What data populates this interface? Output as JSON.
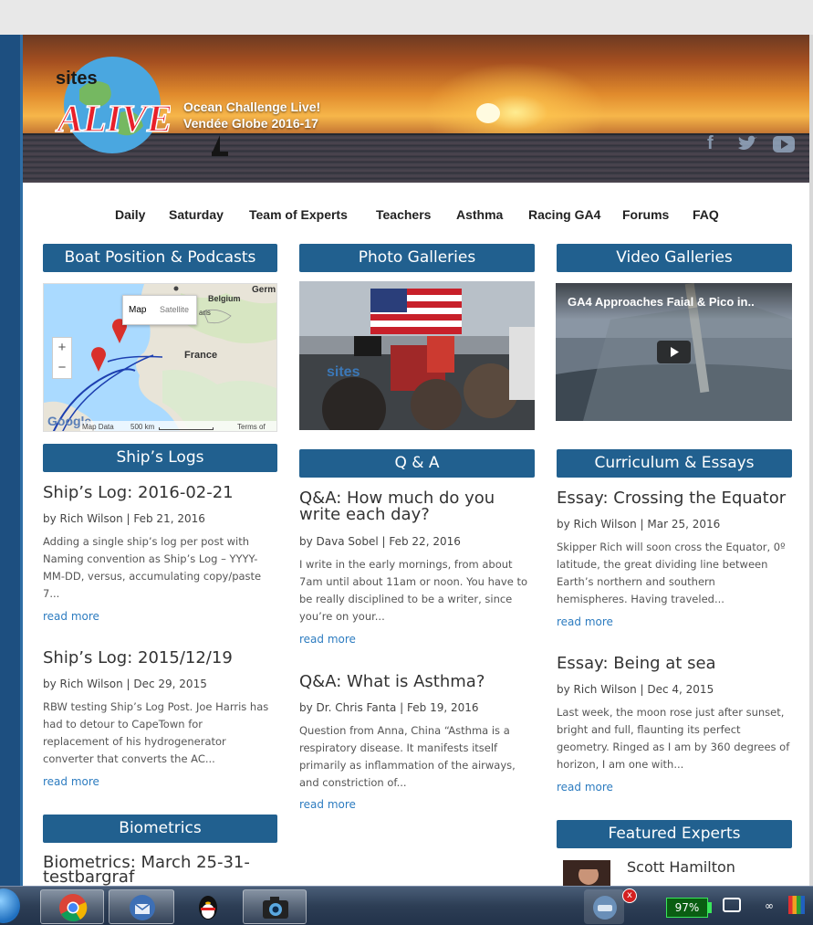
{
  "header": {
    "logo_text_top": "sites",
    "logo_text_main": "ALIVE!",
    "tagline_line1": "Ocean Challenge Live!",
    "tagline_line2": "Vendée Globe 2016-17",
    "social_icons": [
      "facebook-icon",
      "twitter-icon",
      "youtube-icon"
    ]
  },
  "nav": {
    "items": [
      "Daily",
      "Saturday",
      "Team of Experts",
      "Teachers",
      "Asthma",
      "Racing GA4",
      "Forums",
      "FAQ"
    ]
  },
  "sections": {
    "boat_position": "Boat Position & Podcasts",
    "photo_galleries": "Photo Galleries",
    "video_galleries": "Video Galleries",
    "ships_logs": "Ship’s Logs",
    "qa": "Q & A",
    "curriculum": "Curriculum & Essays",
    "biometrics": "Biometrics",
    "featured_experts": "Featured Experts"
  },
  "map": {
    "btn_map": "Map",
    "btn_satellite": "Satellite",
    "label_france": "France",
    "label_belgium": "Belgium",
    "label_germany": "Germ",
    "label_paris": "aris",
    "zoom_in": "+",
    "zoom_out": "−",
    "google": "Google",
    "map_data": "Map Data",
    "scale": "500 km",
    "terms": "Terms of Use"
  },
  "photo": {
    "overlay_text": "sites"
  },
  "video": {
    "title": "GA4 Approaches Faial & Pico in.."
  },
  "ships_logs": [
    {
      "title": "Ship’s Log: 2016-02-21",
      "meta": "by Rich Wilson | Feb 21, 2016",
      "excerpt_lines": [
        "Adding a single ship’s log per post with",
        "Naming convention as Ship’s Log – YYYY-",
        "MM-DD, versus, accumulating copy/paste",
        "7..."
      ],
      "read_more": "read more"
    },
    {
      "title": "Ship’s Log: 2015/12/19",
      "meta": "by Rich Wilson | Dec 29, 2015",
      "excerpt_lines": [
        "RBW testing Ship’s Log Post. Joe Harris has",
        "had to detour to CapeTown for",
        "replacement of his hydrogenerator",
        "converter that converts the AC..."
      ],
      "read_more": "read more"
    }
  ],
  "qa": [
    {
      "title_lines": [
        "Q&A: How much do you",
        "write each day?"
      ],
      "meta": "by Dava Sobel | Feb 22, 2016",
      "excerpt_lines": [
        "I write in the early mornings, from about",
        "7am until about 11am or noon. You have to",
        "be really disciplined to be a writer, since",
        "you’re on your..."
      ],
      "read_more": "read more"
    },
    {
      "title_lines": [
        "Q&A: What is Asthma?"
      ],
      "meta": "by Dr. Chris Fanta | Feb 19, 2016",
      "excerpt_lines": [
        "Question from Anna, China “Asthma is a",
        "respiratory disease. It manifests itself",
        "primarily as inflammation of the airways,",
        "and constriction of..."
      ],
      "read_more": "read more"
    }
  ],
  "essays": [
    {
      "title": "Essay: Crossing the Equator",
      "meta": "by Rich Wilson | Mar 25, 2016",
      "excerpt_lines": [
        "Skipper Rich will soon cross the Equator, 0º",
        "latitude, the great dividing line between",
        "Earth’s northern and southern",
        "hemispheres. Having traveled..."
      ],
      "read_more": "read more"
    },
    {
      "title": "Essay: Being at sea",
      "meta": "by Rich Wilson | Dec 4, 2015",
      "excerpt_lines": [
        "Last week, the moon rose just after sunset,",
        "bright and full, flaunting its perfect",
        "geometry. Ringed as I am by 360 degrees of",
        "horizon, I am one with..."
      ],
      "read_more": "read more"
    }
  ],
  "biometrics": {
    "title_lines": [
      "Biometrics: March 25-31-",
      "testbargraf"
    ]
  },
  "featured_expert": {
    "name": "Scott Hamilton"
  },
  "taskbar": {
    "battery": "97%",
    "notification_badge": "x"
  }
}
